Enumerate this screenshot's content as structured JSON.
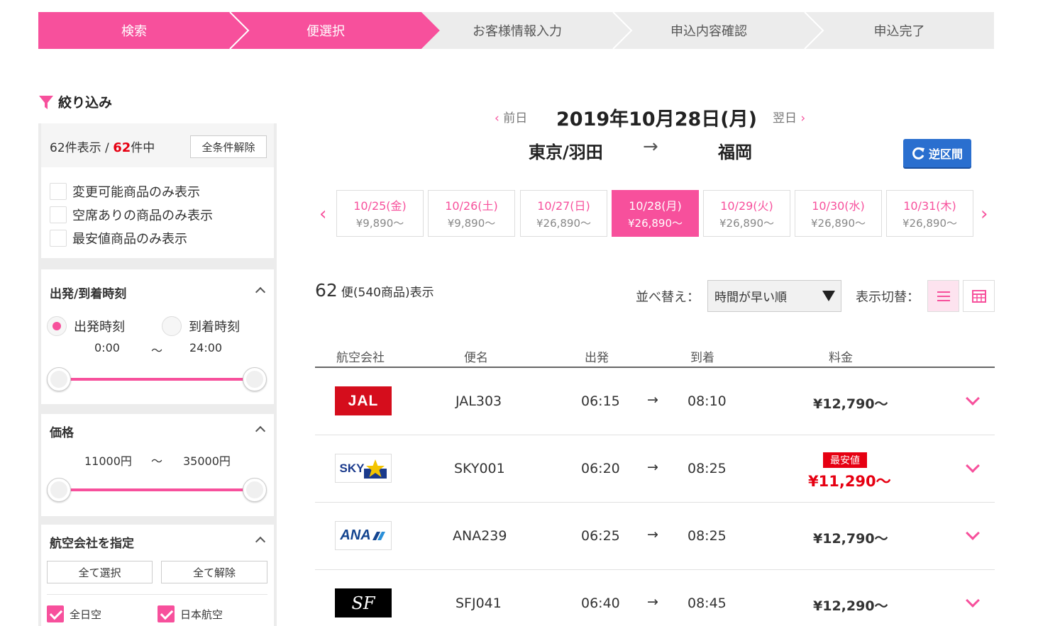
{
  "steps": [
    "検索",
    "便選択",
    "お客様情報入力",
    "申込内容確認",
    "申込完了"
  ],
  "filter": {
    "title": "絞り込み",
    "count_shown": "62件表示",
    "count_sep": " / ",
    "count_total_num": "62",
    "count_total_suffix": "件中",
    "clear_all": "全条件解除",
    "checks": [
      "変更可能商品のみ表示",
      "空席ありの商品のみ表示",
      "最安値商品のみ表示"
    ],
    "time": {
      "title": "出発/到着時刻",
      "opt_depart": "出発時刻",
      "opt_arrive": "到着時刻",
      "min": "0:00",
      "tilde": "～",
      "max": "24:00"
    },
    "price": {
      "title": "価格",
      "min": "11000円",
      "tilde": "～",
      "max": "35000円"
    },
    "airline": {
      "title": "航空会社を指定",
      "select_all": "全て選択",
      "clear_all": "全て解除",
      "opt1": "全日空",
      "opt2": "日本航空"
    }
  },
  "header": {
    "prev": "前日",
    "next": "翌日",
    "date": "2019年10月28日(月)",
    "from": "東京/羽田",
    "arrow": "→",
    "to": "福岡",
    "reverse": "逆区間"
  },
  "days": [
    {
      "d": "10/25(金)",
      "p": "¥9,890～"
    },
    {
      "d": "10/26(土)",
      "p": "¥9,890～"
    },
    {
      "d": "10/27(日)",
      "p": "¥26,890～"
    },
    {
      "d": "10/28(月)",
      "p": "¥26,890～"
    },
    {
      "d": "10/29(火)",
      "p": "¥26,890～"
    },
    {
      "d": "10/30(水)",
      "p": "¥26,890～"
    },
    {
      "d": "10/31(木)",
      "p": "¥26,890～"
    }
  ],
  "results": {
    "count": "62",
    "count_text": "便(540商品)表示",
    "sort_label": "並べ替え：",
    "sort_value": "時間が早い順",
    "view_label": "表示切替："
  },
  "table": {
    "headers": [
      "航空会社",
      "便名",
      "出発",
      "到着",
      "料金"
    ],
    "cheapest_badge": "最安値",
    "rows": [
      {
        "airline": "JAL",
        "flight": "JAL303",
        "dep": "06:15",
        "arrow": "→",
        "arr": "08:10",
        "price": "¥12,790～"
      },
      {
        "airline": "SKY",
        "flight": "SKY001",
        "dep": "06:20",
        "arrow": "→",
        "arr": "08:25",
        "price": "¥11,290～"
      },
      {
        "airline": "ANA",
        "flight": "ANA239",
        "dep": "06:25",
        "arrow": "→",
        "arr": "08:25",
        "price": "¥12,790～"
      },
      {
        "airline": "SF",
        "flight": "SFJ041",
        "dep": "06:40",
        "arrow": "→",
        "arr": "08:45",
        "price": "¥12,290～"
      }
    ]
  },
  "colors": {
    "accent": "#f7509c",
    "sale_red": "#e60012",
    "reverse_blue": "#2a6fcf"
  }
}
